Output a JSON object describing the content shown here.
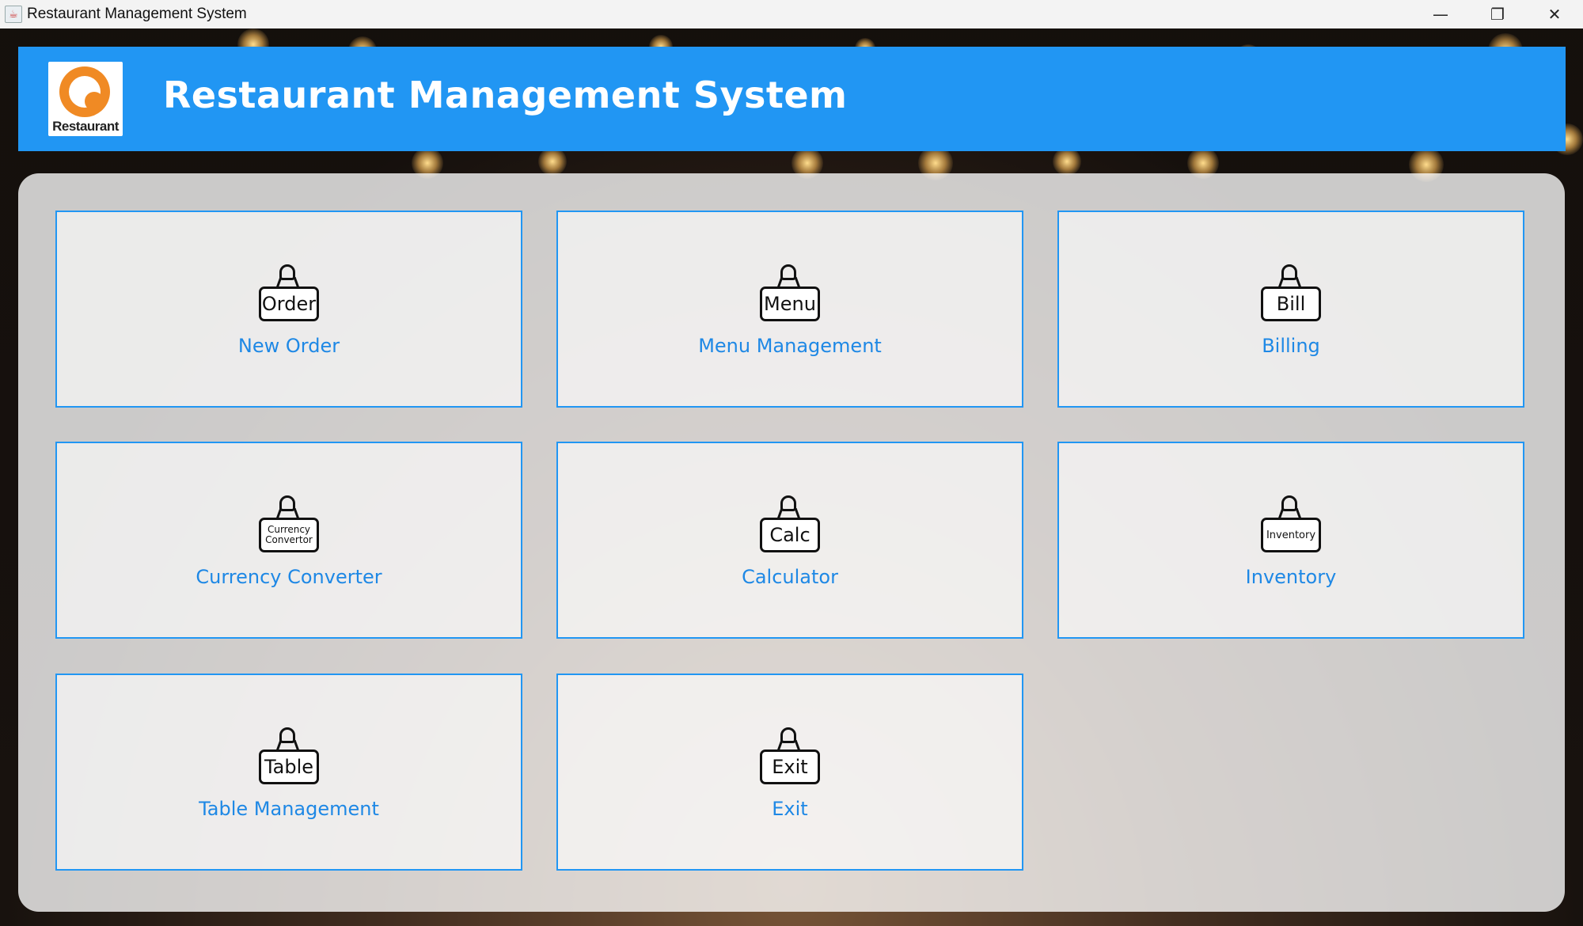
{
  "window": {
    "title": "Restaurant Management System",
    "minimize_icon": "minimize-icon",
    "restore_icon": "restore-icon",
    "close_icon": "close-icon"
  },
  "header": {
    "logo_text": "Restaurant",
    "title": "Restaurant Management System",
    "background_color": "#2196f3"
  },
  "tiles": [
    {
      "label": "New Order",
      "icon_text": "Order"
    },
    {
      "label": "Menu Management",
      "icon_text": "Menu"
    },
    {
      "label": "Billing",
      "icon_text": "Bill"
    },
    {
      "label": "Currency Converter",
      "icon_text": "Currency Convertor"
    },
    {
      "label": "Calculator",
      "icon_text": "Calc"
    },
    {
      "label": "Inventory",
      "icon_text": "Inventory"
    },
    {
      "label": "Table Management",
      "icon_text": "Table"
    },
    {
      "label": "Exit",
      "icon_text": "Exit"
    }
  ],
  "colors": {
    "accent": "#2196f3",
    "label": "#1e88e5"
  }
}
